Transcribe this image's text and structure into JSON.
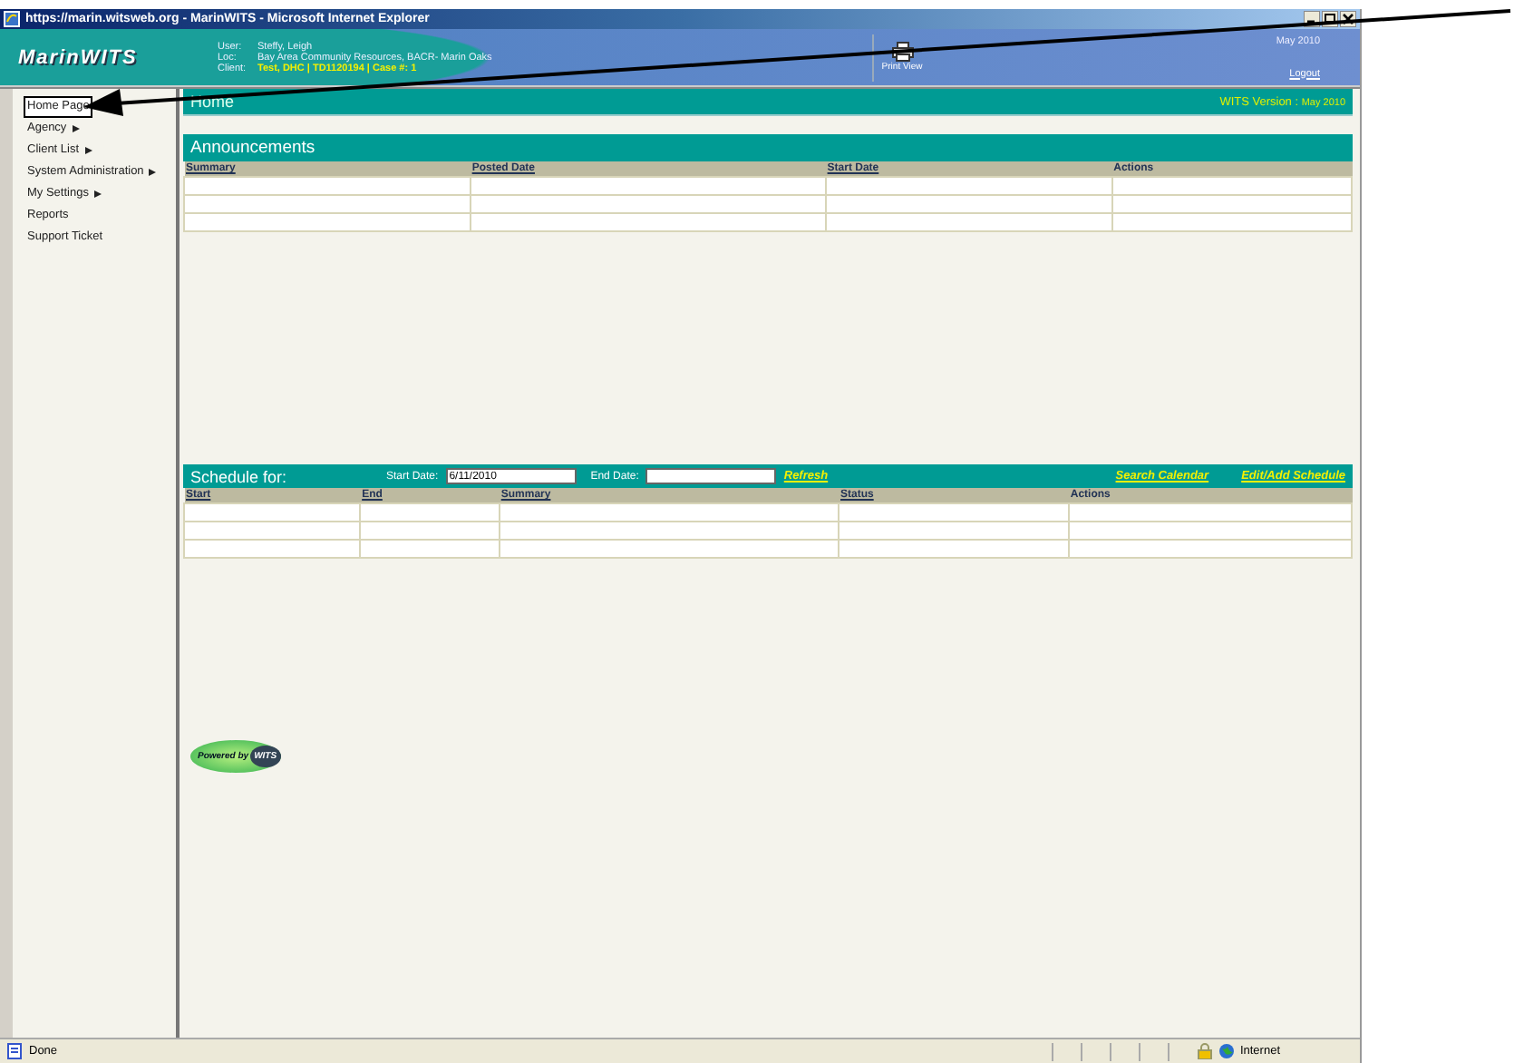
{
  "window": {
    "title": "https://marin.witsweb.org - MarinWITS - Microsoft Internet Explorer"
  },
  "header": {
    "logo": "MarinWITS",
    "info": [
      {
        "label": "User:",
        "value": "Steffy, Leigh",
        "highlight": false
      },
      {
        "label": "Loc:",
        "value": "Bay Area Community Resources, BACR- Marin Oaks",
        "highlight": false
      },
      {
        "label": "Client:",
        "value": "Test, DHC | TD1120194 | Case #: 1",
        "highlight": true
      }
    ],
    "print_view": "Print View",
    "date": "May 2010",
    "logout": "Logout"
  },
  "sidebar": {
    "items": [
      {
        "label": "Home Page",
        "selected": true,
        "submenu": false
      },
      {
        "label": "Agency",
        "selected": false,
        "submenu": true
      },
      {
        "label": "Client List",
        "selected": false,
        "submenu": true
      },
      {
        "label": "System Administration",
        "selected": false,
        "submenu": true
      },
      {
        "label": "My Settings",
        "selected": false,
        "submenu": true
      },
      {
        "label": "Reports",
        "selected": false,
        "submenu": false
      },
      {
        "label": "Support Ticket",
        "selected": false,
        "submenu": false
      }
    ]
  },
  "page": {
    "title": "Home",
    "version_label": "WITS Version :",
    "version": "May 2010"
  },
  "announcements": {
    "title": "Announcements",
    "columns": [
      {
        "label": "Summary",
        "sortable": true
      },
      {
        "label": "Posted Date",
        "sortable": true
      },
      {
        "label": "Start Date",
        "sortable": true
      },
      {
        "label": "Actions",
        "sortable": false
      }
    ]
  },
  "schedule": {
    "title": "Schedule for:",
    "start_label": "Start Date:",
    "start_value": "6/11/2010",
    "end_label": "End Date:",
    "refresh": "Refresh",
    "links": [
      "Search Calendar",
      "Edit/Add Schedule"
    ],
    "columns": [
      {
        "label": "Start",
        "sortable": true
      },
      {
        "label": "End",
        "sortable": true
      },
      {
        "label": "Summary",
        "sortable": true
      },
      {
        "label": "Status",
        "sortable": true
      },
      {
        "label": "Actions",
        "sortable": false
      }
    ]
  },
  "footer_logo": {
    "text": "Powered by",
    "brand": "WITS"
  },
  "status_bar": {
    "status": "Done",
    "zone": "Internet"
  }
}
